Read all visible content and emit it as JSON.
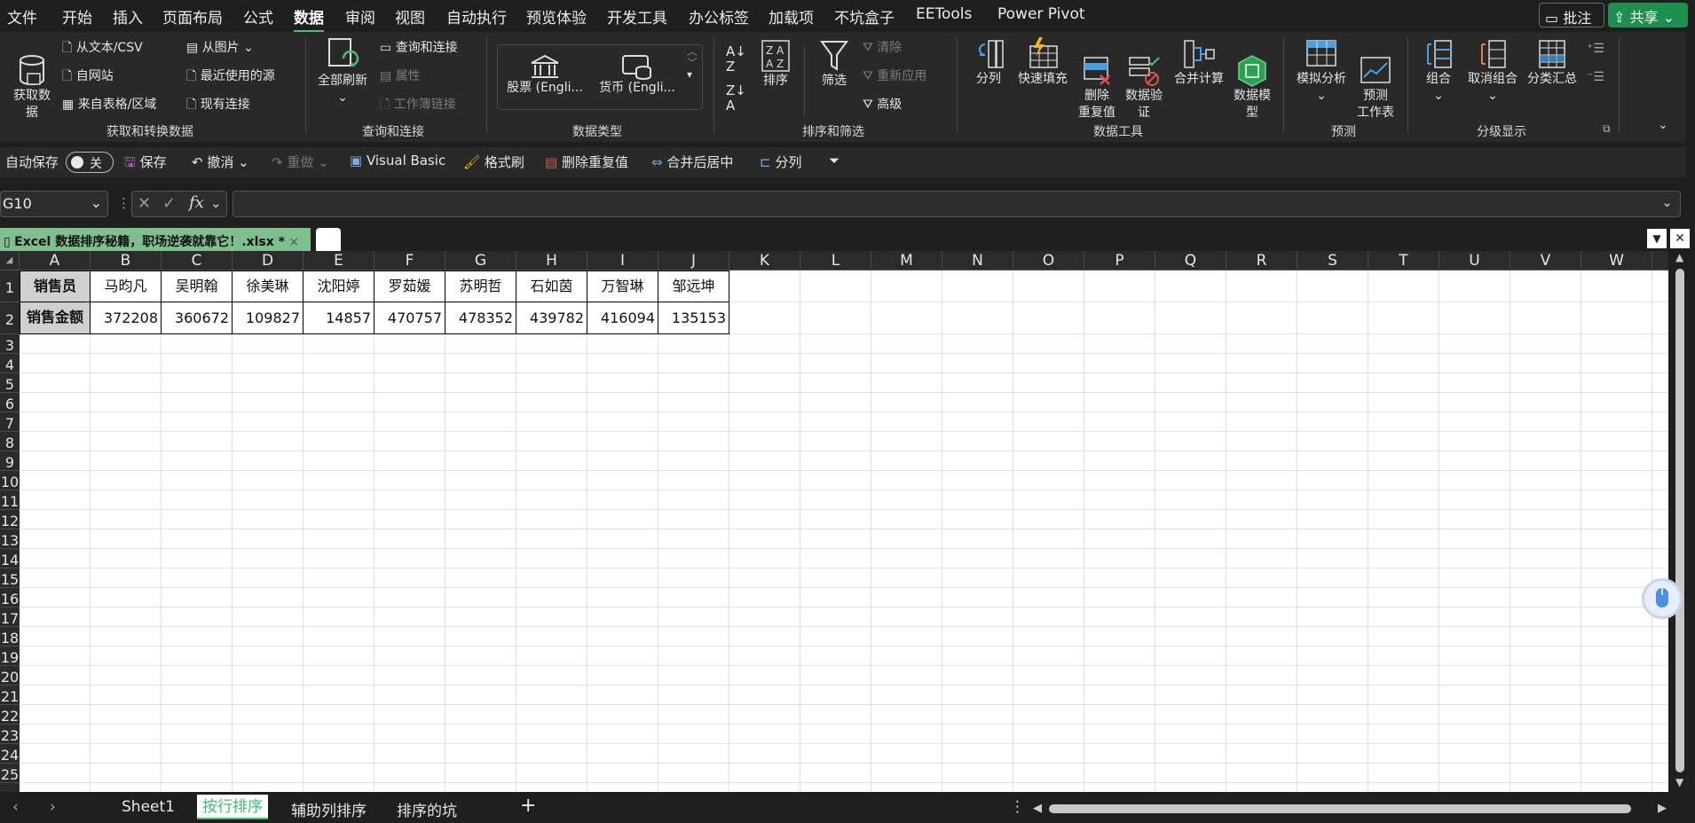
{
  "menu": {
    "tabs": [
      "文件",
      "开始",
      "插入",
      "页面布局",
      "公式",
      "数据",
      "审阅",
      "视图",
      "自动执行",
      "预览体验",
      "开发工具",
      "办公标签",
      "加载项",
      "不坑盒子",
      "EETools",
      "Power Pivot"
    ],
    "active_tab": "数据",
    "comment_label": "批注",
    "share_label": "共享"
  },
  "ribbon": {
    "get_data": {
      "label": "获取数\n据",
      "from_text": "从文本/CSV",
      "from_web": "自网站",
      "from_table": "来自表格/区域",
      "from_picture": "从图片",
      "recent_sources": "最近使用的源",
      "existing_conn": "现有连接",
      "group": "获取和转换数据"
    },
    "queries": {
      "refresh_all": "全部刷新",
      "queries_conn": "查询和连接",
      "properties": "属性",
      "workbook_links": "工作簿链接",
      "group": "查询和连接"
    },
    "data_types": {
      "stocks": "股票 (Engli...",
      "currency": "货币 (Engli...",
      "group": "数据类型"
    },
    "sort_filter": {
      "sort": "排序",
      "filter": "筛选",
      "clear": "清除",
      "reapply": "重新应用",
      "advanced": "高级",
      "group": "排序和筛选"
    },
    "data_tools": {
      "text_to_columns": "分列",
      "flash_fill": "快速填充",
      "remove_dup": "删除\n重复值",
      "validation": "数据验\n证",
      "consolidate": "合并计算",
      "data_model": "数据模\n型",
      "group": "数据工具"
    },
    "forecast": {
      "what_if": "模拟分析",
      "forecast_sheet": "预测\n工作表",
      "group": "预测"
    },
    "outline": {
      "group_btn": "组合",
      "ungroup": "取消组合",
      "subtotal": "分类汇总",
      "group": "分级显示"
    }
  },
  "qat": {
    "autosave": "自动保存",
    "toggle": "关",
    "save": "保存",
    "undo": "撤消",
    "redo": "重做",
    "vba": "Visual Basic",
    "format_painter": "格式刷",
    "remove_dup": "删除重复值",
    "merge_center": "合并后居中",
    "split": "分列"
  },
  "formula_bar": {
    "name_box": "G10",
    "formula": ""
  },
  "doc_tab": {
    "title": "Excel 数据排序秘籍，职场逆袭就靠它！.xlsx *"
  },
  "columns": [
    "A",
    "B",
    "C",
    "D",
    "E",
    "F",
    "G",
    "H",
    "I",
    "J",
    "K",
    "L",
    "M",
    "N",
    "O",
    "P",
    "Q",
    "R",
    "S",
    "T",
    "U",
    "V",
    "W"
  ],
  "rows": [
    "1",
    "2",
    "3",
    "4",
    "5",
    "6",
    "7",
    "8",
    "9",
    "10",
    "11",
    "12",
    "13",
    "14",
    "15",
    "16",
    "17",
    "18",
    "19",
    "20",
    "21",
    "22",
    "23",
    "24",
    "25"
  ],
  "table": {
    "row1": [
      "销售员",
      "马昀凡",
      "吴明翰",
      "徐美琳",
      "沈阳婷",
      "罗茹媛",
      "苏明哲",
      "石如茵",
      "万智琳",
      "邹远坤"
    ],
    "row2": [
      "销售金额",
      "372208",
      "360672",
      "109827",
      "14857",
      "470757",
      "478352",
      "439782",
      "416094",
      "135153"
    ]
  },
  "sheets": [
    "Sheet1",
    "按行排序",
    "辅助列排序",
    "排序的坑"
  ],
  "active_sheet": "按行排序",
  "colors": {
    "accent": "#4fbf6f",
    "share": "#1e8f4e",
    "header_fill": "#d0d0d0"
  }
}
